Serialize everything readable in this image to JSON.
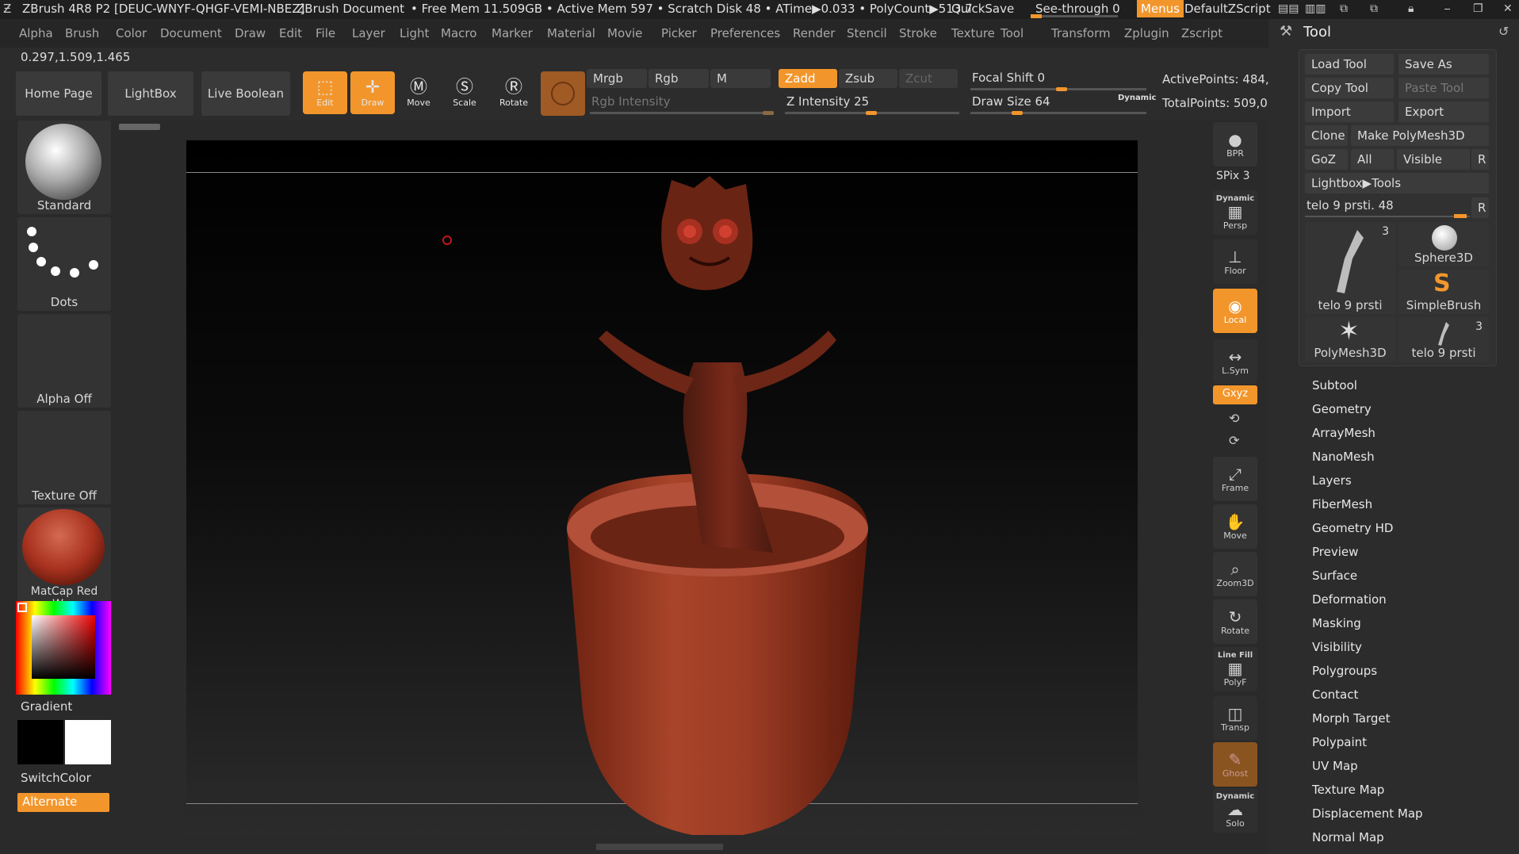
{
  "titlebar": {
    "app": "ZBrush 4R8 P2 [DEUC-WNYF-QHGF-VEMI-NBEZ]",
    "doc": "ZBrush Document",
    "stats": "• Free Mem 11.509GB • Active Mem 597 • Scratch Disk 48 •  ATime▶0.033 • PolyCount▶513.7",
    "quicksave": "QuickSave",
    "seethrough": "See-through  0",
    "menus": "Menus",
    "script": "DefaultZScript"
  },
  "menubar": [
    "Alpha",
    "Brush",
    "Color",
    "Document",
    "Draw",
    "Edit",
    "File",
    "Layer",
    "Light",
    "Macro",
    "Marker",
    "Material",
    "Movie",
    "Picker",
    "Preferences",
    "Render",
    "Stencil",
    "Stroke",
    "Texture",
    "Tool",
    "Transform",
    "Zplugin",
    "Zscript"
  ],
  "coords": "0.297,1.509,1.465",
  "toolbar": {
    "home": "Home Page",
    "lightbox": "LightBox",
    "liveboolean": "Live Boolean",
    "edit": "Edit",
    "draw": "Draw",
    "move": "Move",
    "scale": "Scale",
    "rotate": "Rotate",
    "mrgb": "Mrgb",
    "rgb": "Rgb",
    "m": "M",
    "zadd": "Zadd",
    "zsub": "Zsub",
    "zcut": "Zcut",
    "rgb_intensity": "Rgb Intensity",
    "z_intensity": "Z Intensity 25",
    "focal_shift": "Focal Shift 0",
    "draw_size": "Draw Size 64",
    "dynamic": "Dynamic",
    "active_points": "ActivePoints: 484,",
    "total_points": "TotalPoints: 509,0"
  },
  "leftpanel": {
    "brush": "Standard",
    "stroke": "Dots",
    "alpha": "Alpha Off",
    "texture": "Texture Off",
    "material": "MatCap Red Wax",
    "gradient": "Gradient",
    "switchcolor": "SwitchColor",
    "alternate": "Alternate"
  },
  "shelf": {
    "bpr": "BPR",
    "spix": "SPix 3",
    "dynamic": "Dynamic",
    "persp": "Persp",
    "floor": "Floor",
    "local": "Local",
    "lsym": "L.Sym",
    "xyz": "Gxyz",
    "frame": "Frame",
    "move": "Move",
    "zoom3d": "Zoom3D",
    "rotate": "Rotate",
    "linefill": "Line Fill",
    "polyf": "PolyF",
    "transp": "Transp",
    "ghost": "Ghost",
    "dynamic2": "Dynamic",
    "solo": "Solo"
  },
  "tool": {
    "title": "Tool",
    "load": "Load Tool",
    "saveas": "Save As",
    "copy": "Copy Tool",
    "paste": "Paste Tool",
    "import": "Import",
    "export": "Export",
    "clone": "Clone",
    "make": "Make PolyMesh3D",
    "goz": "GoZ",
    "all": "All",
    "visible": "Visible",
    "r": "R",
    "lightbox_tools": "Lightbox▶Tools",
    "current": "telo 9 prsti. 48",
    "thumbs": [
      {
        "label": "telo 9 prsti",
        "count": "3"
      },
      {
        "label": "Sphere3D",
        "count": ""
      },
      {
        "label": "SimpleBrush",
        "count": ""
      },
      {
        "label": "PolyMesh3D",
        "count": ""
      },
      {
        "label": "telo 9 prsti",
        "count": "3"
      }
    ],
    "sections": [
      "Subtool",
      "Geometry",
      "ArrayMesh",
      "NanoMesh",
      "Layers",
      "FiberMesh",
      "Geometry HD",
      "Preview",
      "Surface",
      "Deformation",
      "Masking",
      "Visibility",
      "Polygroups",
      "Contact",
      "Morph Target",
      "Polypaint",
      "UV Map",
      "Texture Map",
      "Displacement Map",
      "Normal Map"
    ]
  },
  "colors": {
    "accent": "#f2962c",
    "model": "#7a2a1a"
  }
}
